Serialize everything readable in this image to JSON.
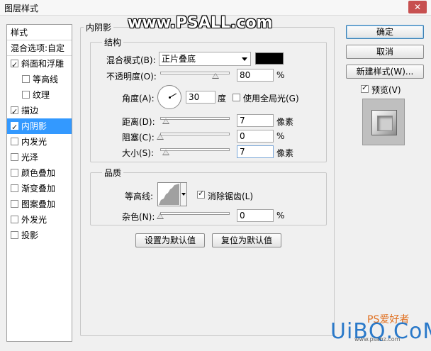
{
  "window": {
    "title": "图层样式",
    "close_glyph": "✕"
  },
  "watermark": "www.PSALL.com",
  "sidebar": {
    "header": "样式",
    "items": [
      {
        "label": "混合选项:自定",
        "checkbox": false,
        "checked": false,
        "indent": false,
        "selected": false
      },
      {
        "label": "斜面和浮雕",
        "checkbox": true,
        "checked": true,
        "indent": false,
        "selected": false
      },
      {
        "label": "等高线",
        "checkbox": true,
        "checked": false,
        "indent": true,
        "selected": false
      },
      {
        "label": "纹理",
        "checkbox": true,
        "checked": false,
        "indent": true,
        "selected": false
      },
      {
        "label": "描边",
        "checkbox": true,
        "checked": true,
        "indent": false,
        "selected": false
      },
      {
        "label": "内阴影",
        "checkbox": true,
        "checked": true,
        "indent": false,
        "selected": true
      },
      {
        "label": "内发光",
        "checkbox": true,
        "checked": false,
        "indent": false,
        "selected": false
      },
      {
        "label": "光泽",
        "checkbox": true,
        "checked": false,
        "indent": false,
        "selected": false
      },
      {
        "label": "颜色叠加",
        "checkbox": true,
        "checked": false,
        "indent": false,
        "selected": false
      },
      {
        "label": "渐变叠加",
        "checkbox": true,
        "checked": false,
        "indent": false,
        "selected": false
      },
      {
        "label": "图案叠加",
        "checkbox": true,
        "checked": false,
        "indent": false,
        "selected": false
      },
      {
        "label": "外发光",
        "checkbox": true,
        "checked": false,
        "indent": false,
        "selected": false
      },
      {
        "label": "投影",
        "checkbox": true,
        "checked": false,
        "indent": false,
        "selected": false
      }
    ]
  },
  "panel": {
    "section_title": "内阴影",
    "structure": {
      "title": "结构",
      "blend_mode_label": "混合模式(B):",
      "blend_mode_value": "正片叠底",
      "swatch_color": "#000000",
      "opacity_label": "不透明度(O):",
      "opacity_value": "80",
      "opacity_unit": "%",
      "angle_label": "角度(A):",
      "angle_value": "30",
      "angle_unit": "度",
      "global_light_label": "使用全局光(G)",
      "global_light_checked": false,
      "distance_label": "距离(D):",
      "distance_value": "7",
      "distance_unit": "像素",
      "choke_label": "阻塞(C):",
      "choke_value": "0",
      "choke_unit": "%",
      "size_label": "大小(S):",
      "size_value": "7",
      "size_unit": "像素"
    },
    "quality": {
      "title": "品质",
      "contour_label": "等高线:",
      "anti_alias_label": "消除锯齿(L)",
      "anti_alias_checked": true,
      "noise_label": "杂色(N):",
      "noise_value": "0",
      "noise_unit": "%"
    },
    "buttons": {
      "set_default": "设置为默认值",
      "reset_default": "复位为默认值"
    }
  },
  "actions": {
    "ok": "确定",
    "cancel": "取消",
    "new_style": "新建样式(W)...",
    "preview_label": "预览(V)",
    "preview_checked": true
  },
  "logo": {
    "main": "UiBQ.CoM",
    "sub": "PS爱好者",
    "url": "www.psahz.com"
  }
}
